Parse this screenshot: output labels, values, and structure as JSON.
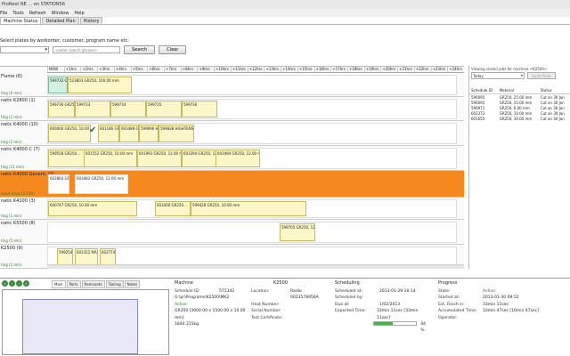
{
  "window": {
    "title": "ProNest NE ... on STATION56"
  },
  "menu": [
    "File",
    "Tools",
    "Refresh",
    "Window",
    "Help"
  ],
  "tabs": [
    "Machine Status",
    "Detailed Plan",
    "History"
  ],
  "select": {
    "label": "Select plates by workorder, customer, program name etc:",
    "placeholder": "<enter search phrase>",
    "search_label": "Search",
    "clear_label": "Clear"
  },
  "timeline_hours": [
    "NOW",
    "+1hrs",
    "+2hrs",
    "+3hrs",
    "+4hrs",
    "+5hrs",
    "+6hrs",
    "+7hrs",
    "+8hrs",
    "+9hrs",
    "+10hrs",
    "+11hrs",
    "+12hrs",
    "+13hrs",
    "+14hrs",
    "+15hrs",
    "+16hrs",
    "+17hrs",
    "+18hrs",
    "+19hrs",
    "+20hrs",
    "+21hrs",
    "+22hrs",
    "+23hrs",
    "+24hrs"
  ],
  "machines": [
    {
      "name": "Flame (6)",
      "note": "",
      "status": "ting (0 min)",
      "jobs": [
        "599732 GR250...",
        "523803 GR250, 100.00 mm"
      ]
    },
    {
      "name": "natic K2800 (1)",
      "note": "",
      "status": "ting (1 min)",
      "jobs": [
        "599736 GR250, 10.00 mm",
        "599733",
        "599734",
        "599735",
        "599736"
      ]
    },
    {
      "name": "natic K4000 (10)",
      "note": "",
      "status": "ting (2 min)",
      "jobs": [
        "600000 GR250, 10.00 mm",
        "601186 GR250...",
        "603489 GR250...",
        "599696 HIGH...",
        "599838 HIGHTENS..."
      ]
    },
    {
      "name": "natic K4000 C (7)",
      "note": "",
      "status": "ting (11 min)",
      "jobs": [
        "599558 GR250...",
        "601552 GR250, 10.00 mm",
        "601993 GR250, 12.00 mm",
        "603394 GR250, 12.00 mm",
        "603494 GR250, 12.00 mm"
      ]
    },
    {
      "name": "natic K4000 Generic (2)",
      "note": "",
      "status": "nned since (17:40)",
      "jobs": [
        "602864 GR250, 12...",
        "603483 GR250, 12.00 mm"
      ]
    },
    {
      "name": "natic K4100 (3)",
      "note": "",
      "status": "ting (1 min)",
      "jobs": [
        "600747 GR250, 10.00 mm",
        "603400 GR250...",
        "599428 GR250, 10.00 mm"
      ]
    },
    {
      "name": "natic K5500 (8)",
      "note": "",
      "status": "ting (5 min)",
      "jobs": [
        "599705 GR250, 12.00 mm"
      ]
    },
    {
      "name": "K2500 (9)",
      "note": "",
      "status": "ting (1 min)",
      "jobs": [
        "599254 GR250...",
        "602352 MAXA...",
        "602774 HIGH..."
      ]
    }
  ],
  "right_panel": {
    "title": "Viewing closed jobs for machine <K2500>",
    "filter": "Today",
    "audit_label": "Audit Plate",
    "columns": [
      "Schedule ID",
      "Material",
      "Status"
    ],
    "rows": [
      [
        "596095",
        "GR250, 25.00 mm",
        "Cut on 30 Jan"
      ],
      [
        "596095",
        "GR250, 10.00 mm",
        "Cut on 30 Jan"
      ],
      [
        "596971",
        "GR250, 6.00 mm",
        "Cut on 30 Jan"
      ],
      [
        "602372",
        "GR250, 10.00 mm",
        "Cut on 30 Jan"
      ],
      [
        "601655",
        "GR250, 30.00 mm",
        "Cut on 30 Jan"
      ]
    ]
  },
  "bottom": {
    "tabs": [
      "Main",
      "Parts",
      "Remnants",
      "Tooling",
      "Notes"
    ],
    "machine": {
      "heading": "Machine",
      "machine_name": "K2500",
      "schedule_id_label": "Schedule ID:",
      "schedule_id": "575342",
      "path": "G:\\pr\\Programs\\K2500\\MK2",
      "status": "Active",
      "material": "GR350 [3000.00 x 1500.00 x 10.00 mm]",
      "weight": "1844.315kg",
      "location_label": "Location:",
      "location": "Radio 0023578956A",
      "heat_label": "Heat Number:",
      "serial_label": "Serial Number:",
      "test_label": "Test Certificate:"
    },
    "scheduling": {
      "heading": "Scheduling",
      "rows": [
        [
          "Scheduled at:",
          "2013-01-29 10:14"
        ],
        [
          "Scheduled by:",
          ""
        ],
        [
          "Due at:",
          "1/02/2013"
        ],
        [
          "Expected Time:",
          "33min 11sec [33min 11sec]"
        ]
      ],
      "progress_pct": "44 %",
      "progress_fraction": 0.44
    },
    "progress": {
      "heading": "Progress",
      "rows": [
        [
          "State:",
          "Active"
        ],
        [
          "Started at:",
          "2013-01-30 09:52"
        ],
        [
          "Est. Finish in:",
          "33min 11sec"
        ],
        [
          "Accumulated Time:",
          "10min 47sec [10min 47sec]"
        ],
        [
          "Operator:",
          ""
        ]
      ]
    }
  }
}
